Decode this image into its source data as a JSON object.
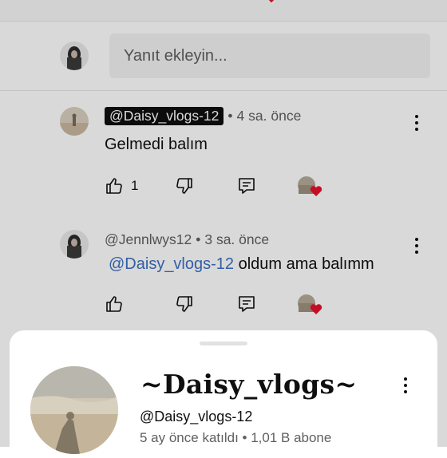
{
  "reply_box": {
    "placeholder": "Yanıt ekleyin..."
  },
  "comments": [
    {
      "handle": "@Daisy_vlogs-12",
      "handle_highlighted": true,
      "time": "4 sa. önce",
      "text": "Gelmedi balım",
      "mention": "",
      "like_count": "1",
      "creator_heart": true
    },
    {
      "handle": "@Jennlwys12",
      "handle_highlighted": false,
      "time": "3 sa. önce",
      "mention": "@Daisy_vlogs-12",
      "text": " oldum ama balımm",
      "like_count": "",
      "creator_heart": true
    }
  ],
  "meta_separator": "•",
  "channel_sheet": {
    "name": "~Daisy_vlogs~",
    "handle": "@Daisy_vlogs-12",
    "joined_and_subs": "5 ay önce katıldı • 1,01 B abone"
  },
  "colors": {
    "mention": "#3b6fc2",
    "heart": "#e8112d",
    "secondary_text": "#606060"
  },
  "icons": [
    "thumb-up-icon",
    "thumb-down-icon",
    "reply-icon",
    "heart-icon",
    "more-vert-icon"
  ]
}
